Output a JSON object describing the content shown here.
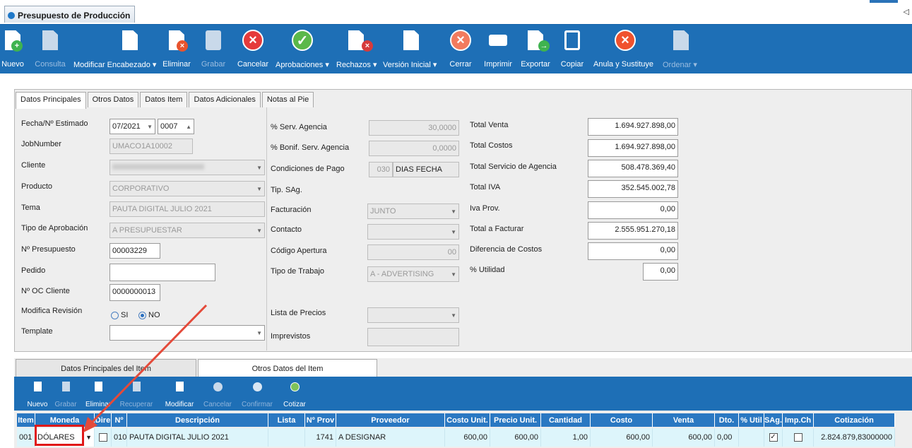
{
  "window_tab": "Presupuesto de Producción",
  "toolbar": [
    {
      "label": "Nuevo",
      "icon": "new-doc-icon",
      "enabled": true
    },
    {
      "label": "Consulta",
      "icon": "query-icon",
      "enabled": false
    },
    {
      "label": "Modificar Encabezado ▾",
      "icon": "edit-icon",
      "enabled": true
    },
    {
      "label": "Eliminar",
      "icon": "delete-doc-icon",
      "enabled": true
    },
    {
      "label": "Grabar",
      "icon": "save-icon",
      "enabled": false
    },
    {
      "label": "Cancelar",
      "icon": "cancel-icon",
      "enabled": true
    },
    {
      "label": "Aprobaciones ▾",
      "icon": "approve-icon",
      "enabled": true
    },
    {
      "label": "Rechazos ▾",
      "icon": "reject-icon",
      "enabled": true
    },
    {
      "label": "Versión Inicial ▾",
      "icon": "version-icon",
      "enabled": true
    },
    {
      "label": "Cerrar",
      "icon": "close-icon",
      "enabled": true
    },
    {
      "label": "Imprimir",
      "icon": "print-icon",
      "enabled": true
    },
    {
      "label": "Exportar",
      "icon": "export-icon",
      "enabled": true
    },
    {
      "label": "Copiar",
      "icon": "copy-icon",
      "enabled": true
    },
    {
      "label": "Anula y Sustituye",
      "icon": "void-icon",
      "enabled": true
    },
    {
      "label": "Ordenar ▾",
      "icon": "order-icon",
      "enabled": false
    }
  ],
  "tabs": [
    "Datos Principales",
    "Otros Datos",
    "Datos Item",
    "Datos Adicionales",
    "Notas al Pie"
  ],
  "form": {
    "fecha_label": "Fecha/Nº Estimado",
    "fecha_value": "07/2021",
    "estimado_value": "0007",
    "jobnumber_label": "JobNumber",
    "jobnumber_value": "UMACO1A10002",
    "cliente_label": "Cliente",
    "producto_label": "Producto",
    "producto_value": "CORPORATIVO",
    "tema_label": "Tema",
    "tema_value": "PAUTA DIGITAL JULIO 2021",
    "tipo_aprob_label": "Tipo de Aprobación",
    "tipo_aprob_value": "A PRESUPUESTAR",
    "presupuesto_label": "Nº Presupuesto",
    "presupuesto_value": "00003229",
    "pedido_label": "Pedido",
    "oc_label": "Nº OC Cliente",
    "oc_value": "0000000013",
    "modifica_label": "Modifica Revisión",
    "si_label": "SI",
    "no_label": "NO",
    "template_label": "Template",
    "serv_agencia_label": "% Serv. Agencia",
    "serv_agencia_value": "30,0000",
    "bonif_label": "% Bonif. Serv. Agencia",
    "bonif_value": "0,0000",
    "cond_pago_label": "Condiciones de Pago",
    "cond_pago_code": "030",
    "cond_pago_value": "DIAS FECHA",
    "tip_sag_label": "Tip. SAg.",
    "facturacion_label": "Facturación",
    "facturacion_value": "JUNTO",
    "contacto_label": "Contacto",
    "codigo_label": "Código Apertura",
    "codigo_value": "00",
    "tipo_trabajo_label": "Tipo de Trabajo",
    "tipo_trabajo_value": "A - ADVERTISING",
    "lista_label": "Lista de Precios",
    "imprevistos_label": "Imprevistos",
    "total_venta_label": "Total Venta",
    "total_venta_value": "1.694.927.898,00",
    "total_costos_label": "Total Costos",
    "total_costos_value": "1.694.927.898,00",
    "total_serv_label": "Total Servicio de Agencia",
    "total_serv_value": "508.478.369,40",
    "total_iva_label": "Total IVA",
    "total_iva_value": "352.545.002,78",
    "iva_prov_label": "Iva Prov.",
    "iva_prov_value": "0,00",
    "total_fact_label": "Total a Facturar",
    "total_fact_value": "2.555.951.270,18",
    "dif_label": "Diferencia de Costos",
    "dif_value": "0,00",
    "utilidad_label": "% Utilidad",
    "utilidad_value": "0,00"
  },
  "subtabs": [
    "Datos Principales del Item",
    "Otros Datos del Item"
  ],
  "subtoolbar": [
    {
      "label": "Nuevo",
      "enabled": true
    },
    {
      "label": "Grabar",
      "enabled": false
    },
    {
      "label": "Eliminar",
      "enabled": true
    },
    {
      "label": "Recuperar",
      "enabled": false
    },
    {
      "label": "Modificar",
      "enabled": true
    },
    {
      "label": "Cancelar",
      "enabled": false
    },
    {
      "label": "Confirmar",
      "enabled": false
    },
    {
      "label": "Cotizar",
      "enabled": true
    }
  ],
  "grid": {
    "headers": [
      "Item",
      "Moneda",
      "Dire",
      "Nº",
      "Descripción",
      "Lista",
      "Nº Prov",
      "Proveedor",
      "Costo Unit.",
      "Precio Unit.",
      "Cantidad",
      "Costo",
      "Venta",
      "Dto.",
      "% Util",
      "SAg.",
      "Imp.Ch",
      "Cotización"
    ],
    "row": {
      "item": "001",
      "moneda": "DÓLARES",
      "n": "010",
      "descripcion": "PAUTA DIGITAL JULIO 2021",
      "nprov": "1741",
      "proveedor": "A DESIGNAR",
      "costo_unit": "600,00",
      "precio_unit": "600,00",
      "cantidad": "1,00",
      "costo": "600,00",
      "venta": "600,00",
      "dto": "0,00",
      "cotizacion": "2.824.879,83000000"
    }
  },
  "colors": {
    "toolbar": "#1e6fb6",
    "grid_header": "#2a78c2",
    "highlight": "#e01818"
  }
}
